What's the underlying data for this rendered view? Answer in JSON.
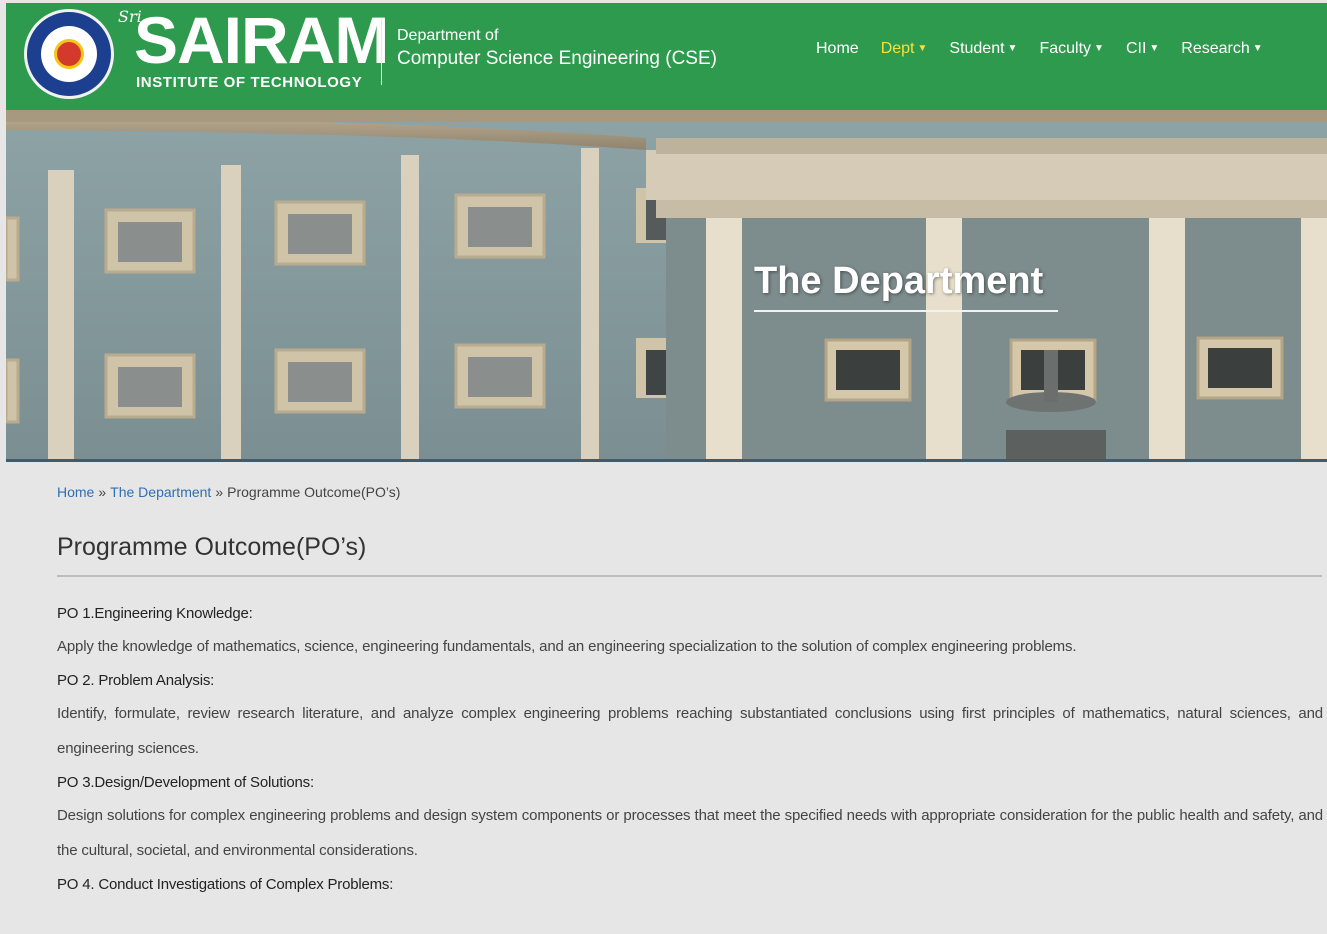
{
  "header": {
    "brand_sri": "Sri",
    "brand_name": "SAIRAM",
    "brand_sub": "INSTITUTE OF TECHNOLOGY",
    "dept_line1": "Department of",
    "dept_line2": "Computer Science Engineering (CSE)",
    "bg_color": "#2e9a4e",
    "nav": [
      {
        "label": "Home",
        "dropdown": false,
        "active": false
      },
      {
        "label": "Dept",
        "dropdown": true,
        "active": true
      },
      {
        "label": "Student",
        "dropdown": true,
        "active": false
      },
      {
        "label": "Faculty",
        "dropdown": true,
        "active": false
      },
      {
        "label": "CII",
        "dropdown": true,
        "active": false
      },
      {
        "label": "Research",
        "dropdown": true,
        "active": false
      }
    ],
    "active_color": "#f4e23c"
  },
  "banner": {
    "title": "The Department"
  },
  "breadcrumb": {
    "home": "Home",
    "sep": "»",
    "department": "The Department",
    "current": "Programme Outcome(PO’s)"
  },
  "page_title": "Programme Outcome(PO’s)",
  "outcomes": [
    {
      "heading": "PO 1.Engineering Knowledge:",
      "text": "Apply the knowledge of mathematics, science, engineering fundamentals, and an engineering specialization to the solution of complex engineering problems."
    },
    {
      "heading": "PO 2. Problem Analysis:",
      "text": "Identify, formulate, review research literature, and analyze complex engineering problems reaching substantiated conclusions using first principles of mathematics, natural sciences, and engineering sciences."
    },
    {
      "heading": "PO 3.Design/Development of Solutions:",
      "text": "Design solutions for complex engineering problems and design system components or processes that meet the specified needs with appropriate consideration for the public health and safety, and the cultural, societal, and environmental considerations."
    },
    {
      "heading": "PO 4. Conduct Investigations of Complex Problems:",
      "text": ""
    }
  ],
  "link_color": "#2f6fb2"
}
